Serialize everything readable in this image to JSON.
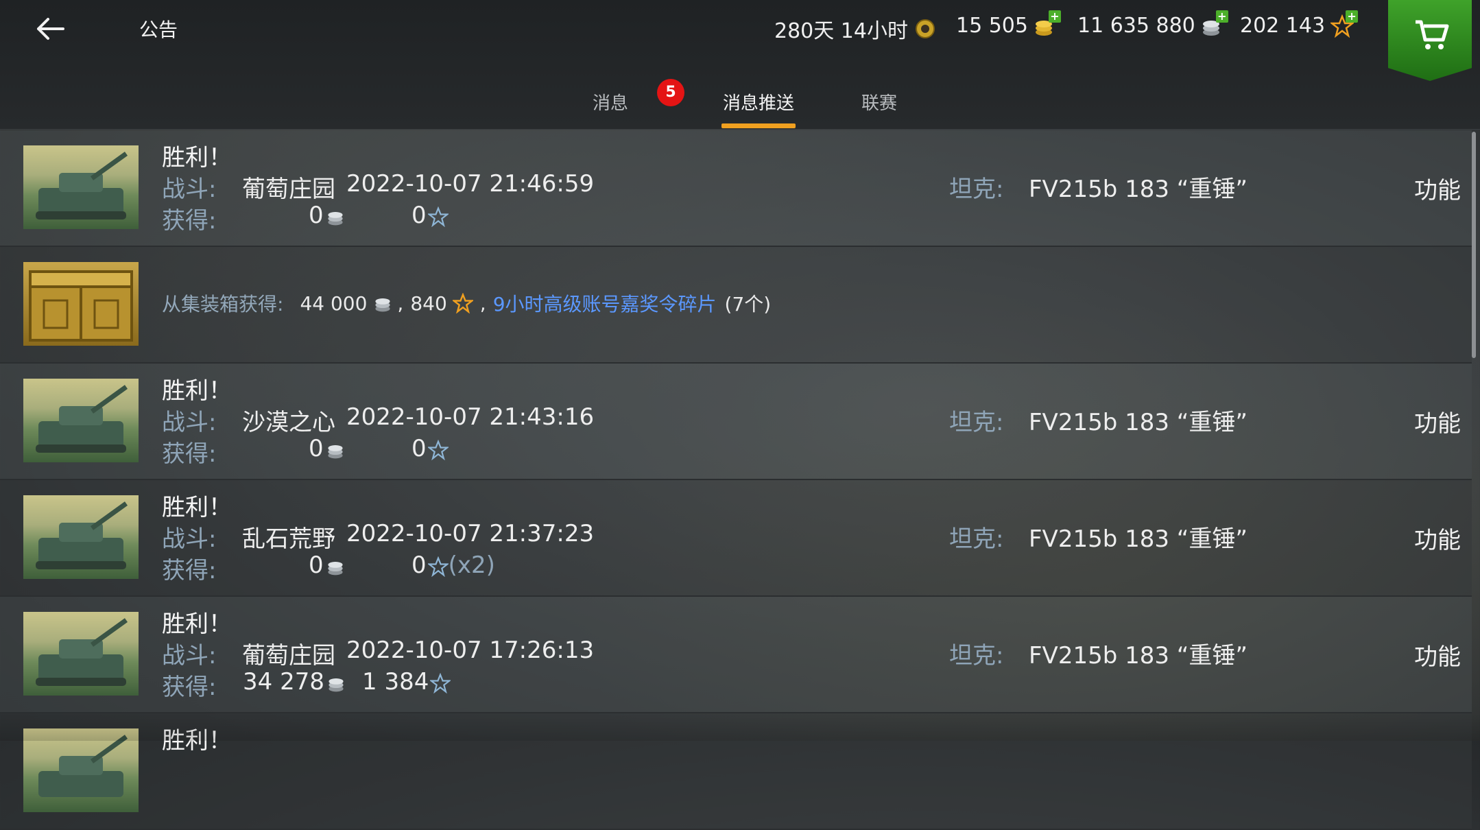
{
  "header": {
    "title": "公告",
    "premium_time": "280天 14小时",
    "gold": "15 505",
    "credits": "11 635 880",
    "free_xp": "202 143"
  },
  "tabs": [
    {
      "label": "消息",
      "badge": "5"
    },
    {
      "label": "消息推送"
    },
    {
      "label": "联赛"
    }
  ],
  "labels": {
    "battle": "战斗:",
    "earned": "获得:",
    "tank": "坦克:",
    "function": "功能"
  },
  "messages": [
    {
      "type": "battle",
      "title": "胜利！",
      "map": "葡萄庄园",
      "datetime": "2022-10-07 21:46:59",
      "credits": "0",
      "xp": "0",
      "xp_extra": "",
      "tank": "FV215b 183 “重锤”"
    },
    {
      "type": "crate",
      "from_label": "从集装箱获得:",
      "credits": "44 000",
      "sep1": ",",
      "xp": "840",
      "sep2": ",",
      "item_link": "9小时高级账号嘉奖令碎片",
      "item_count": "(7个)"
    },
    {
      "type": "battle",
      "title": "胜利！",
      "map": "沙漠之心",
      "datetime": "2022-10-07 21:43:16",
      "credits": "0",
      "xp": "0",
      "xp_extra": "",
      "tank": "FV215b 183 “重锤”"
    },
    {
      "type": "battle",
      "title": "胜利！",
      "map": "乱石荒野",
      "datetime": "2022-10-07 21:37:23",
      "credits": "0",
      "xp": "0",
      "xp_extra": "(x2)",
      "tank": "FV215b 183 “重锤”"
    },
    {
      "type": "battle",
      "title": "胜利！",
      "map": "葡萄庄园",
      "datetime": "2022-10-07 17:26:13",
      "credits": "34 278",
      "xp": "1 384",
      "xp_extra": "",
      "tank": "FV215b 183 “重锤”"
    },
    {
      "type": "battle",
      "title": "胜利！"
    }
  ],
  "colors": {
    "accent_tab": "#f0a020",
    "badge": "#e41414",
    "link": "#5b98ff",
    "label": "#8fa5b8",
    "shop": "#2f8f1f"
  },
  "icons": {
    "back": "arrow-left-icon",
    "premium": "premium-laurel-icon",
    "gold": "gold-coins-icon",
    "credits": "silver-credits-icon",
    "xp": "star-xp-icon",
    "shop": "cart-icon"
  }
}
